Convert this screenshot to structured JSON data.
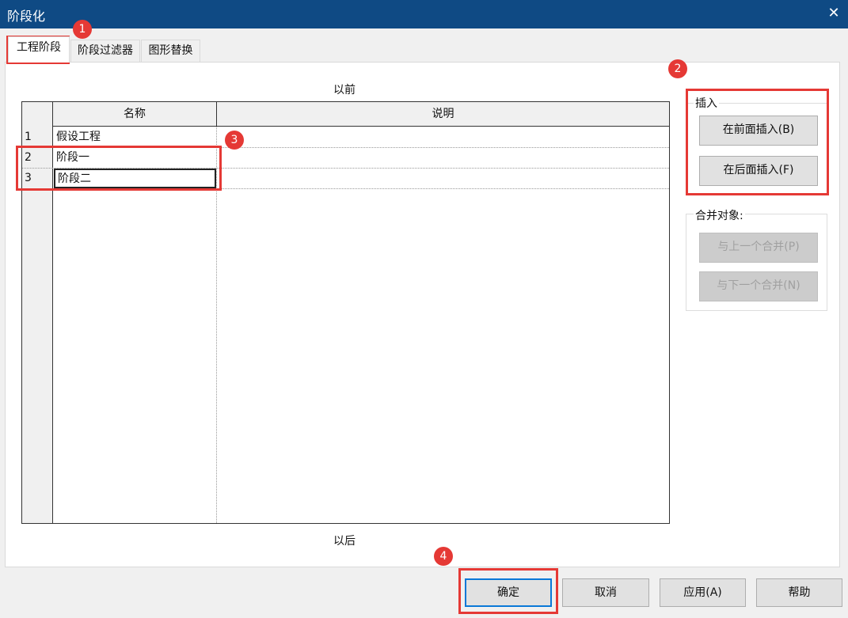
{
  "window": {
    "title": "阶段化",
    "close_glyph": "✕"
  },
  "tabs": [
    {
      "label": "工程阶段",
      "active": true
    },
    {
      "label": "阶段过滤器"
    },
    {
      "label": "图形替换"
    }
  ],
  "grid": {
    "before_label": "以前",
    "after_label": "以后",
    "columns": [
      "名称",
      "说明"
    ],
    "rows": [
      {
        "num": "1",
        "name": "假设工程",
        "desc": ""
      },
      {
        "num": "2",
        "name": "阶段一",
        "desc": ""
      },
      {
        "num": "3",
        "name": "阶段二",
        "desc": ""
      }
    ]
  },
  "insert_group": {
    "label": "插入",
    "before_button": "在前面插入(B)",
    "after_button": "在后面插入(F)"
  },
  "merge_group": {
    "label": "合并对象:",
    "prev_button": "与上一个合并(P)",
    "next_button": "与下一个合并(N)"
  },
  "footer": {
    "ok": "确定",
    "cancel": "取消",
    "apply": "应用(A)",
    "help": "帮助"
  },
  "annotations": [
    "1",
    "2",
    "3",
    "4"
  ],
  "colors": {
    "titlebar": "#0f4a84",
    "annotation": "#e53935",
    "default_button": "#0a78d7"
  }
}
